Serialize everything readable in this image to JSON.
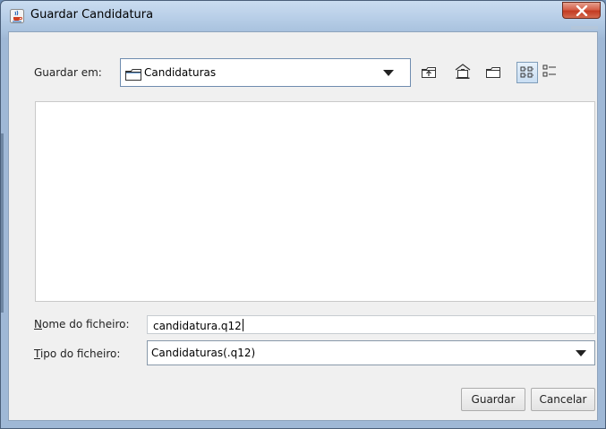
{
  "window": {
    "title": "Guardar Candidatura",
    "icon": "java-cup-icon",
    "close_icon": "close-icon"
  },
  "look_in": {
    "label": "Guardar em:",
    "value": "Candidaturas",
    "icon": "folder-icon"
  },
  "toolbar": {
    "up_folder": "up-one-level-icon",
    "home": "home-icon",
    "new_folder": "new-folder-icon",
    "list_view": "list-view-icon",
    "details_view": "details-view-icon"
  },
  "file_name": {
    "label_underline": "N",
    "label_rest": "ome do ficheiro:",
    "value": "candidatura.q12"
  },
  "file_type": {
    "label_underline": "T",
    "label_rest": "ipo do ficheiro:",
    "value": "Candidaturas(.q12)"
  },
  "buttons": {
    "save": "Guardar",
    "cancel": "Cancelar"
  }
}
